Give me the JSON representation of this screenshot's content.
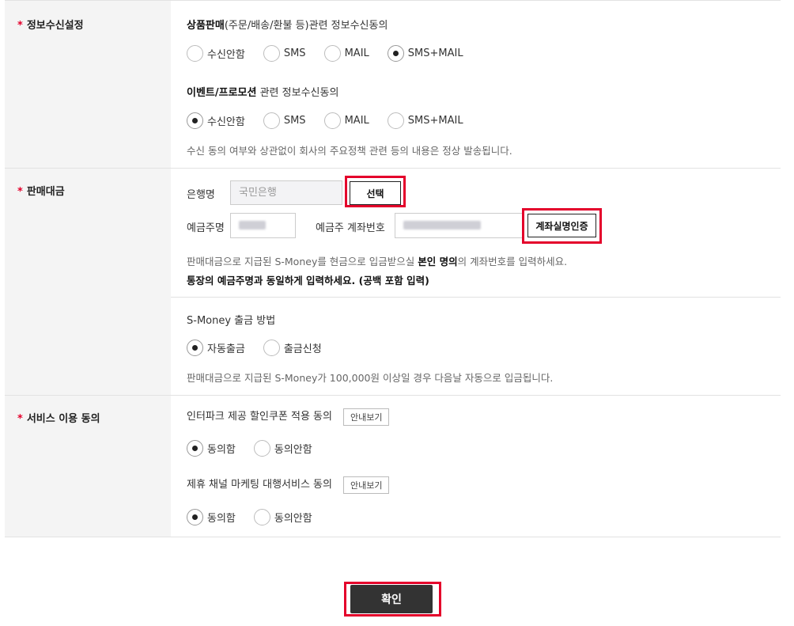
{
  "sections": {
    "info": {
      "label": "정보수신설정",
      "sale_title_bold": "상품판매",
      "sale_title_rest": "(주문/배송/환불 등)관련 정보수신동의",
      "sale_options": [
        "수신안함",
        "SMS",
        "MAIL",
        "SMS+MAIL"
      ],
      "sale_selected": "SMS+MAIL",
      "event_title_bold": "이벤트/프로모션",
      "event_title_rest": " 관련 정보수신동의",
      "event_options": [
        "수신안함",
        "SMS",
        "MAIL",
        "SMS+MAIL"
      ],
      "event_selected": "수신안함",
      "notice": "수신 동의 여부와 상관없이 회사의 주요정책 관련 등의 내용은 정상 발송됩니다."
    },
    "payment": {
      "label": "판매대금",
      "bank_label": "은행명",
      "bank_value": "국민은행",
      "select_button": "선택",
      "holder_label": "예금주명",
      "account_label": "예금주 계좌번호",
      "verify_button": "계좌실명인증",
      "notice1_pre": "판매대금으로 지급된 S-Money를 현금으로 입금받으실 ",
      "notice1_bold": "본인 명의",
      "notice1_post": "의 계좌번호를 입력하세요.",
      "notice2": "통장의 예금주명과 동일하게 입력하세요. (공백 포함 입력)",
      "smoney_title": "S-Money 출금 방법",
      "smoney_options": [
        "자동출금",
        "출금신청"
      ],
      "smoney_selected": "자동출금",
      "smoney_notice": "판매대금으로 지급된 S-Money가 100,000원 이상일 경우 다음날 자동으로 입금됩니다."
    },
    "service": {
      "label": "서비스 이용 동의",
      "coupon_title": "인터파크 제공 할인쿠폰 적용 동의",
      "coupon_info_button": "안내보기",
      "coupon_options": [
        "동의함",
        "동의안함"
      ],
      "coupon_selected": "동의함",
      "marketing_title": "제휴 채널 마케팅 대행서비스 동의",
      "marketing_info_button": "안내보기",
      "marketing_options": [
        "동의함",
        "동의안함"
      ],
      "marketing_selected": "동의함"
    }
  },
  "required_mark": "*",
  "confirm_button": "확인",
  "colors": {
    "required": "#e4002b",
    "highlight": "#e4002b",
    "confirm_bg": "#333333",
    "label_bg": "#f4f4f4"
  }
}
